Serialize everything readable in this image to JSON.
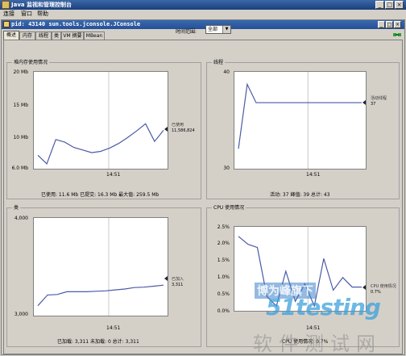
{
  "window": {
    "title": "Java 监视和管理控制台"
  },
  "menu": [
    "连接",
    "窗口",
    "帮助"
  ],
  "inner_window": {
    "title": "pid: 43140 sun.tools.jconsole.JConsole"
  },
  "tabs": [
    "概述",
    "内存",
    "线程",
    "类",
    "VM 摘要",
    "MBean"
  ],
  "active_tab": 0,
  "time_range": {
    "label": "时间范围:",
    "value": "全部"
  },
  "panels": {
    "heap": {
      "title": "堆内存使用情况",
      "y_ticks": [
        "20 Mb",
        "15 Mb",
        "10 Mb",
        "6.0 Mb"
      ],
      "x_tick": "14:51",
      "side_label": "已使用",
      "side_value": "11,586,824",
      "footer": "已使用: 11.6 Mb    已提交: 16.3 Mb    最大值: 259.5 Mb"
    },
    "threads": {
      "title": "线程",
      "y_ticks": [
        "40",
        "30"
      ],
      "x_tick": "14:51",
      "side_label": "活动线程",
      "side_value": "37",
      "footer": "活动: 37    峰值: 39    总计: 43"
    },
    "classes": {
      "title": "类",
      "y_ticks": [
        "4,000",
        "3,000"
      ],
      "x_tick": "14:51",
      "side_label": "已加入",
      "side_value": "3,311",
      "footer": "已加载: 3,311    未加载: 0    总计: 3,311"
    },
    "cpu": {
      "title": "CPU 使用情况",
      "y_ticks": [
        "2.5%",
        "2.0%",
        "1.5%",
        "1.0%",
        "0.5%",
        "0.0%"
      ],
      "x_tick": "14:51",
      "side_label": "CPU 使用情况",
      "side_value": "0.7%",
      "footer": "CPU 使用情况: 0.7%"
    }
  },
  "watermark": {
    "line1": "博为峰旗下",
    "logo": "51testing",
    "line2": "软件测试网"
  },
  "chart_data": [
    {
      "type": "line",
      "title": "堆内存使用情况",
      "ylim": [
        6.0,
        20
      ],
      "x_tick": "14:51",
      "series": [
        {
          "name": "已使用",
          "values": [
            7.8,
            6.5,
            10.2,
            9.8,
            9.0,
            8.6,
            8.2,
            8.4,
            8.9,
            9.6,
            10.5,
            11.5,
            12.6,
            9.9,
            11.6
          ]
        }
      ]
    },
    {
      "type": "line",
      "title": "线程",
      "ylim": [
        30,
        40
      ],
      "x_tick": "14:51",
      "series": [
        {
          "name": "活动线程",
          "values": [
            32,
            39,
            37,
            37,
            37,
            37,
            37,
            37,
            37,
            37,
            37,
            37,
            37,
            37,
            37
          ]
        }
      ]
    },
    {
      "type": "line",
      "title": "类",
      "ylim": [
        3000,
        4000
      ],
      "x_tick": "14:51",
      "series": [
        {
          "name": "已加入",
          "values": [
            3090,
            3205,
            3210,
            3240,
            3240,
            3240,
            3245,
            3250,
            3260,
            3270,
            3285,
            3290,
            3300,
            3311
          ]
        }
      ]
    },
    {
      "type": "line",
      "title": "CPU 使用情况",
      "ylim": [
        0.0,
        2.5
      ],
      "x_tick": "14:51",
      "series": [
        {
          "name": "CPU 使用情况",
          "values": [
            2.3,
            2.05,
            1.95,
            0.4,
            0.1,
            1.2,
            0.25,
            0.8,
            0.1,
            1.6,
            0.6,
            1.0,
            0.7,
            0.7
          ]
        }
      ]
    }
  ]
}
